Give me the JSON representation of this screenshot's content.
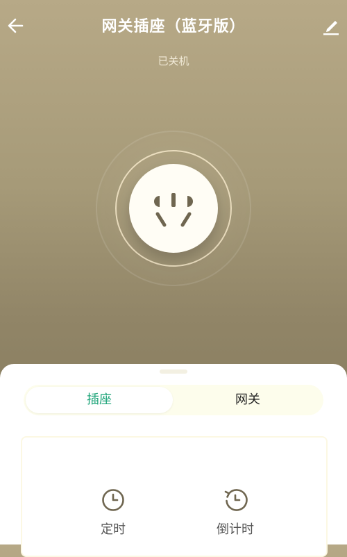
{
  "header": {
    "title": "网关插座（蓝牙版）",
    "status": "已关机",
    "back_icon": "arrow-left-icon",
    "edit_icon": "pencil-icon"
  },
  "power": {
    "icon": "socket-icon",
    "state": "off"
  },
  "tabs": [
    {
      "label": "插座",
      "active": true
    },
    {
      "label": "网关",
      "active": false
    }
  ],
  "features": [
    {
      "label": "定时",
      "icon": "clock-icon"
    },
    {
      "label": "倒计时",
      "icon": "countdown-icon"
    }
  ],
  "colors": {
    "accent": "#1aa377",
    "background_top": "#b7a987",
    "background_bottom": "#7f7558",
    "icon": "#6f6650"
  }
}
